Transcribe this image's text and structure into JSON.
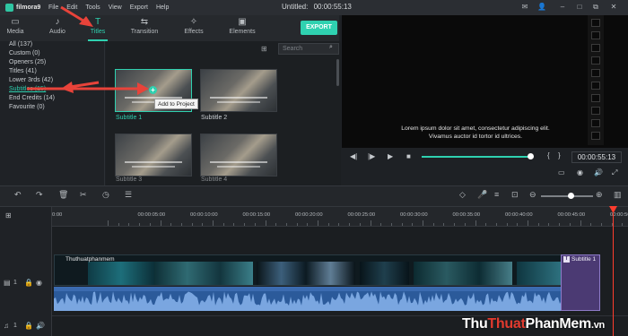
{
  "app": {
    "logo_text": "filmora9",
    "document_title": "Untitled:",
    "document_time": "00:00:55:13",
    "menu": [
      "File",
      "Edit",
      "Tools",
      "View",
      "Export",
      "Help"
    ]
  },
  "tabs": [
    {
      "label": "Media",
      "icon": "media-icon"
    },
    {
      "label": "Audio",
      "icon": "music-note-icon"
    },
    {
      "label": "Titles",
      "icon": "text-icon",
      "active": true
    },
    {
      "label": "Transition",
      "icon": "transition-icon"
    },
    {
      "label": "Effects",
      "icon": "effects-icon"
    },
    {
      "label": "Elements",
      "icon": "image-icon"
    }
  ],
  "export_label": "EXPORT",
  "categories": [
    "All (137)",
    "Custom (0)",
    "Openers (25)",
    "Titles (41)",
    "Lower 3rds (42)",
    "Subtitles (15)",
    "End Credits (14)",
    "Favourite (0)"
  ],
  "active_category_index": 5,
  "search": {
    "placeholder": "Search"
  },
  "thumbnails": [
    {
      "label": "Subtitle 1",
      "selected": true
    },
    {
      "label": "Subtitle 2"
    },
    {
      "label": "Subtitle 3"
    },
    {
      "label": "Subtitle 4"
    }
  ],
  "tooltip": "Add to Project",
  "preview": {
    "text_line1": "Lorem ipsum dolor sit amet, consectetur adipiscing elit.",
    "text_line2": "Vivamus auctor id tortor id ultrices.",
    "timecode": "00:00:55:13",
    "progress": 0.97,
    "bracket_left": "{",
    "bracket_right": "}"
  },
  "ruler": {
    "ticks": [
      "0:00",
      "00:00:05:00",
      "00:00:10:00",
      "00:00:15:00",
      "00:00:20:00",
      "00:00:25:00",
      "00:00:30:00",
      "00:00:35:00",
      "00:00:40:00",
      "00:00:45:00",
      "00:00:50:00"
    ]
  },
  "tracks": {
    "video_track_number": "1",
    "audio_track_number": "1",
    "video_clip_name": "Thuthuatphanmem",
    "subtitle_clip_name": "Subtitle 1",
    "subtitle_clip_icon": "T"
  },
  "zoom_level": 0.5,
  "watermark": {
    "part1": "Thu",
    "part2": "Thuat",
    "part3": "PhanMem",
    "part4": ".vn"
  },
  "colors": {
    "accent": "#2fd1b0",
    "playhead": "#ff3d2e",
    "subtitle_clip": "#4b3a73",
    "audio_wave": "#2b5a9a"
  }
}
